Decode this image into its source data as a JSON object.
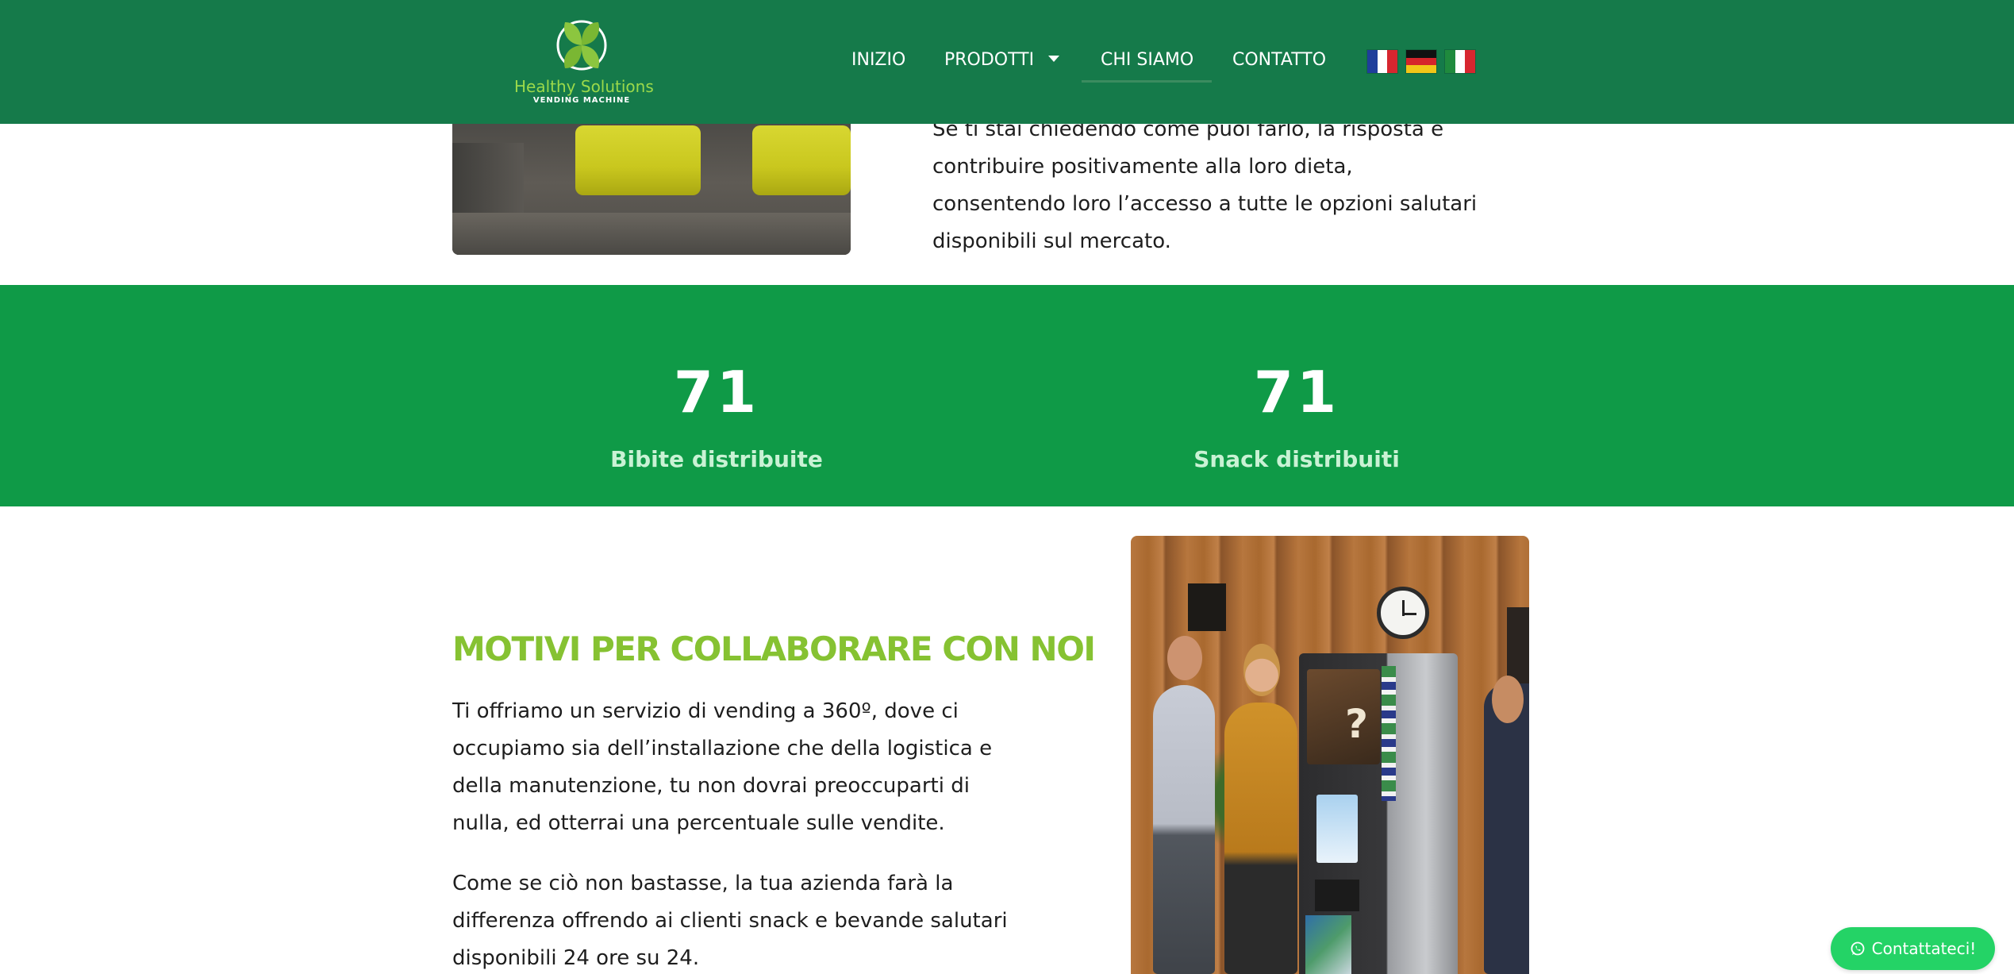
{
  "header": {
    "logo": {
      "name": "Healthy Solutions",
      "tagline": "VENDING MACHINE"
    },
    "nav": [
      {
        "label": "INIZIO",
        "active": false
      },
      {
        "label": "PRODOTTI",
        "active": false,
        "has_dropdown": true
      },
      {
        "label": "CHI SIAMO",
        "active": true
      },
      {
        "label": "CONTATTO",
        "active": false
      }
    ],
    "languages": [
      {
        "icon": "flag-france-icon"
      },
      {
        "icon": "flag-germany-icon"
      },
      {
        "icon": "flag-italy-icon"
      }
    ]
  },
  "intro": {
    "paragraph": "Se ti stai chiedendo come puoi farlo, la risposta è contribuire positivamente alla loro dieta, consentendo loro l’accesso a tutte le opzioni salutari disponibili sul mercato."
  },
  "counters": [
    {
      "value": "71",
      "label": "Bibite distribuite"
    },
    {
      "value": "71",
      "label": "Snack distribuiti"
    }
  ],
  "reasons": {
    "title": "MOTIVI PER COLLABORARE CON NOI",
    "paragraphs": [
      "Ti offriamo un servizio di vending a 360º, dove ci occupiamo sia dell’installazione che della logistica e della manutenzione, tu non dovrai preoccuparti di nulla, ed otterrai una percentuale sulle vendite.",
      "Come se ciò non bastasse, la tua azienda farà la differenza offrendo ai clienti snack e bevande salutari disponibili 24 ore su 24."
    ]
  },
  "contact_button": {
    "label": "Contattateci!",
    "icon": "whatsapp-icon"
  },
  "colors": {
    "header_bg": "#157a4a",
    "band_bg": "#0f9a47",
    "accent_green": "#86c232",
    "contact_btn": "#24d366"
  }
}
